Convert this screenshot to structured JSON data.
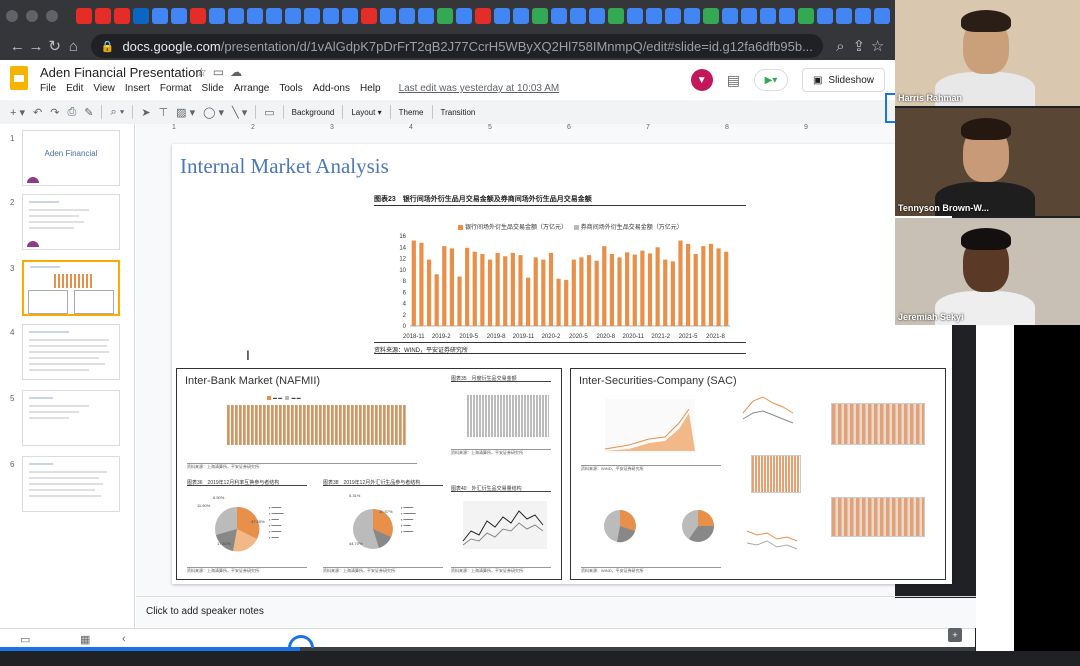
{
  "browser": {
    "url_host": "docs.google.com",
    "url_path": "/presentation/d/1vAlGdpK7pDrFrT2qB2J77CcrH5WByXQ2Hl758IMnmpQ/edit#slide=id.g12fa6dfb95b...",
    "favicon_colors": [
      "#e52d27",
      "#e52d27",
      "#e52d27",
      "#0a66c2",
      "#4285f4",
      "#4285f4",
      "#e52d27",
      "#4285f4",
      "#4285f4",
      "#4285f4",
      "#4285f4",
      "#4285f4",
      "#4285f4",
      "#4285f4",
      "#4285f4",
      "#e52d27",
      "#4285f4",
      "#4285f4",
      "#4285f4",
      "#34a853",
      "#4285f4",
      "#e52d27",
      "#4285f4",
      "#4285f4",
      "#34a853",
      "#4285f4",
      "#4285f4",
      "#4285f4",
      "#34a853",
      "#4285f4",
      "#4285f4",
      "#4285f4",
      "#4285f4",
      "#34a853",
      "#4285f4",
      "#4285f4",
      "#4285f4",
      "#4285f4",
      "#34a853",
      "#4285f4",
      "#4285f4",
      "#4285f4",
      "#4285f4"
    ]
  },
  "slides_app": {
    "doc_title": "Aden Financial Presentation",
    "menu": [
      "File",
      "Edit",
      "View",
      "Insert",
      "Format",
      "Slide",
      "Arrange",
      "Tools",
      "Add-ons",
      "Help"
    ],
    "last_edit": "Last edit was yesterday at 10:03 AM",
    "slideshow_label": "Slideshow",
    "toolbar": {
      "background": "Background",
      "layout": "Layout",
      "theme": "Theme",
      "transition": "Transition"
    },
    "ruler": [
      "1",
      "2",
      "3",
      "4",
      "5",
      "6",
      "7",
      "8",
      "9"
    ],
    "speaker_notes_placeholder": "Click to add speaker notes",
    "accent_color": "#f9ab00"
  },
  "filmstrip": [
    {
      "num": "1",
      "title": "Aden Financial"
    },
    {
      "num": "2",
      "title": ""
    },
    {
      "num": "3",
      "title": ""
    },
    {
      "num": "4",
      "title": ""
    },
    {
      "num": "5",
      "title": ""
    },
    {
      "num": "6",
      "title": ""
    }
  ],
  "slide": {
    "title": "Internal Market Analysis",
    "top_figure": {
      "header": "图表23　银行间场外衍生品月交易金额及券商间场外衍生品月交易金额",
      "legend": [
        "银行间场外衍生品交易金额（万亿元）",
        "券商间场外衍生品交易金额（万亿元）"
      ],
      "source": "资料来源：WIND，平安证券研究所"
    },
    "panel_left": {
      "title": "Inter-Bank Market (NAFMII)",
      "fig_a_header": "图表35　月度衍生品交易金额",
      "fig_b_header": "图表36　2019年12月利率互换参与者结构",
      "fig_c_header": "图表38　2019年12月外汇衍生品参与者结构",
      "fig_d_header": "图表40　外汇衍生品交易量结构",
      "source": "资料来源：上海清算所，平安证券研究所",
      "pie_b_labels": [
        "11.90%",
        "6.50%",
        "47.55%",
        "17.61%"
      ],
      "pie_c_labels": [
        "0.31%",
        "0.44%",
        "39.57%",
        "11.17%",
        "0.41%",
        "44.70%"
      ]
    },
    "panel_right": {
      "title": "Inter-Securities-Company (SAC)",
      "source": "资料来源：WIND，平安证券研究所"
    }
  },
  "chart_data": {
    "type": "bar",
    "title": "银行间场外衍生品月交易金额及券商间场外衍生品月交易金额",
    "x_tick_labels": [
      "2018-11",
      "2019-2",
      "2019-5",
      "2019-8",
      "2019-11",
      "2020-2",
      "2020-5",
      "2020-8",
      "2020-11",
      "2021-2",
      "2021-5",
      "2021-8"
    ],
    "ylim": [
      0,
      16
    ],
    "y_ticks": [
      0,
      2,
      4,
      6,
      8,
      10,
      12,
      14,
      16
    ],
    "series": [
      {
        "name": "银行间场外衍生品交易金额（万亿元）",
        "color": "#e8904a",
        "values": [
          15.2,
          14.8,
          11.8,
          9.2,
          14.2,
          13.8,
          8.8,
          13.9,
          13.2,
          12.8,
          11.8,
          13.0,
          12.4,
          13.0,
          12.6,
          8.6,
          12.2,
          11.8,
          13.0,
          8.4,
          8.2,
          11.8,
          12.2,
          12.6,
          11.6,
          14.2,
          12.8,
          12.2,
          13.1,
          12.7,
          13.4,
          12.9,
          14.0,
          11.8,
          11.5,
          15.2,
          14.6,
          12.8,
          14.2,
          14.6,
          13.8,
          13.2
        ]
      },
      {
        "name": "券商间场外衍生品交易金额（万亿元）",
        "color": "#bbbbbb",
        "values": [
          0.1,
          0.1,
          0.1,
          0.1,
          0.1,
          0.1,
          0.1,
          0.1,
          0.1,
          0.1,
          0.1,
          0.1,
          0.1,
          0.1,
          0.1,
          0.1,
          0.1,
          0.1,
          0.1,
          0.1,
          0.1,
          0.1,
          0.1,
          0.1,
          0.1,
          0.1,
          0.1,
          0.1,
          0.1,
          0.1,
          0.1,
          0.1,
          0.1,
          0.1,
          0.1,
          0.1,
          0.1,
          0.1,
          0.1,
          0.1,
          0.1,
          0.1
        ]
      }
    ]
  },
  "participants": [
    {
      "name": "Harris Rahman",
      "bg": "#d9c7b0",
      "skin": "#c9a07a",
      "hair": "#2a1e16",
      "shirt": "#e8e8e8"
    },
    {
      "name": "Tennyson Brown-W...",
      "bg": "#5a4634",
      "skin": "#c99a78",
      "hair": "#241810",
      "shirt": "#1e1e1e"
    },
    {
      "name": "Jeremiah Sekyi",
      "bg": "#c8c0b4",
      "skin": "#5a3a26",
      "hair": "#151010",
      "shirt": "#eeeeee"
    }
  ]
}
